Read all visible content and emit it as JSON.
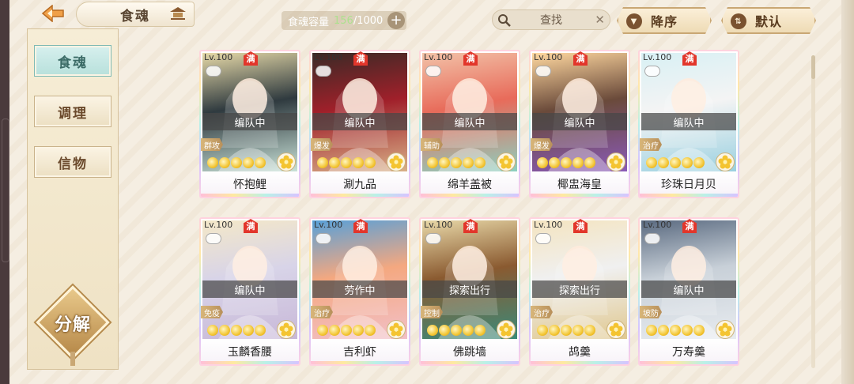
{
  "header": {
    "title": "食魂",
    "capacity_label": "食魂容量",
    "capacity_current": "156",
    "capacity_max": "/1000",
    "capacity_plus": "+",
    "search_placeholder": "查找",
    "search_clear": "✕",
    "sort_order_label": "降序",
    "sort_default_label": "默认"
  },
  "sidebar": {
    "tabs": [
      {
        "label": "食魂",
        "active": true
      },
      {
        "label": "调理",
        "active": false
      },
      {
        "label": "信物",
        "active": false
      }
    ],
    "decompose_label": "分解"
  },
  "cards": [
    {
      "level": "Lv.100",
      "full": "满",
      "status": "编队中",
      "role": "群攻",
      "name": "怀抱鲤",
      "colors": [
        "#e6d9a8",
        "#2f3a3f",
        "#c9e2d8"
      ]
    },
    {
      "level": "Lv.100",
      "full": "满",
      "status": "编队中",
      "role": "爆发",
      "name": "涮九品",
      "colors": [
        "#3a2a26",
        "#a0202a",
        "#d8b088"
      ]
    },
    {
      "level": "Lv.100",
      "full": "满",
      "status": "编队中",
      "role": "辅助",
      "name": "绵羊盖被",
      "colors": [
        "#f2c2a8",
        "#e86b5a",
        "#8cd0c0"
      ]
    },
    {
      "level": "Lv.100",
      "full": "满",
      "status": "编队中",
      "role": "爆发",
      "name": "椰盅海皇",
      "colors": [
        "#ffd8a0",
        "#6a4a3a",
        "#8a5ab8"
      ]
    },
    {
      "level": "Lv.100",
      "full": "满",
      "status": "编队中",
      "role": "治疗",
      "name": "珍珠日月贝",
      "colors": [
        "#d8f0f4",
        "#f4f4f4",
        "#9ad0e0"
      ]
    },
    {
      "level": "Lv.100",
      "full": "满",
      "status": "编队中",
      "role": "免疫",
      "name": "玉麟香腰",
      "colors": [
        "#f4e8c8",
        "#d8d4e8",
        "#c8b8d8"
      ]
    },
    {
      "level": "Lv.100",
      "full": "满",
      "status": "劳作中",
      "role": "治疗",
      "name": "吉利虾",
      "colors": [
        "#58a0d8",
        "#f4a880",
        "#f2c0c8"
      ]
    },
    {
      "level": "Lv.100",
      "full": "满",
      "status": "探索出行",
      "role": "控制",
      "name": "佛跳墙",
      "colors": [
        "#e8d8a8",
        "#8a5a30",
        "#3a8a7a"
      ]
    },
    {
      "level": "Lv.100",
      "full": "满",
      "status": "探索出行",
      "role": "治疗",
      "name": "鸪羹",
      "colors": [
        "#f4e4c0",
        "#f0f0f0",
        "#e0c890"
      ]
    },
    {
      "level": "Lv.100",
      "full": "满",
      "status": "编队中",
      "role": "坡防",
      "name": "万寿羹",
      "colors": [
        "#5a6a80",
        "#c8d0d8",
        "#e8ecf0"
      ]
    }
  ]
}
